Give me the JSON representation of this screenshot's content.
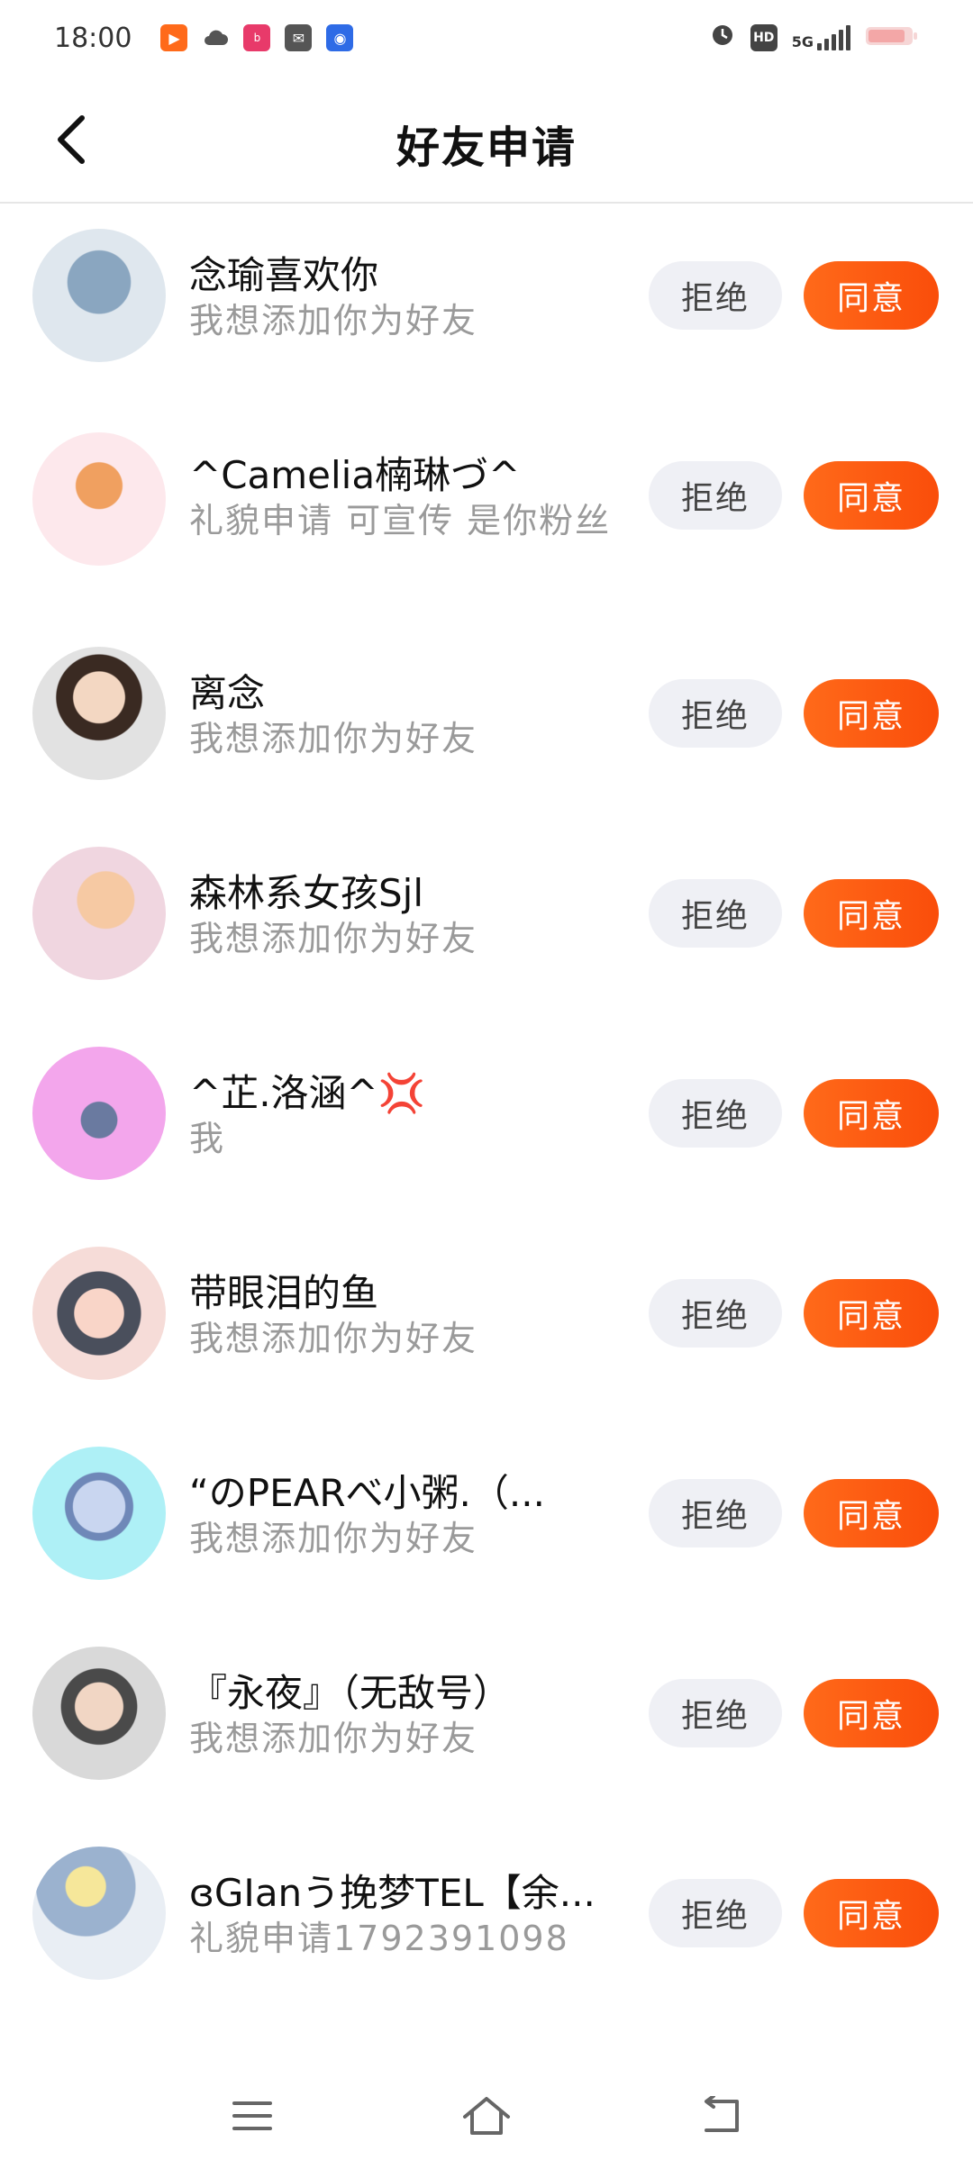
{
  "status_bar": {
    "time": "18:00",
    "network": "5G",
    "hd_label": "HD",
    "icons": [
      "kuaishou-icon",
      "cloud-icon",
      "bilibili-icon",
      "mail-icon",
      "baidu-icon",
      "alarm-icon",
      "hd-icon",
      "signal-icon",
      "battery-icon"
    ]
  },
  "header": {
    "title": "好友申请",
    "back_icon": "chevron-left-icon"
  },
  "actions": {
    "reject": "拒绝",
    "accept": "同意"
  },
  "requests": [
    {
      "name": "念瑜喜欢你",
      "message": "我想添加你为好友",
      "avatar_colors": [
        "#dfe7ee",
        "#8aa6c0"
      ]
    },
    {
      "name": "^Camelia楠琳づ^",
      "message": "礼貌申请 可宣传 是你粉丝",
      "avatar_colors": [
        "#fde8ec",
        "#f0a060"
      ]
    },
    {
      "name": "离念",
      "message": "我想添加你为好友",
      "avatar_colors": [
        "#e2e2e2",
        "#3a2a22"
      ]
    },
    {
      "name": "森林系女孩Sjl",
      "message": "我想添加你为好友",
      "avatar_colors": [
        "#f0d6e0",
        "#f6c9a3"
      ]
    },
    {
      "name": "^芷.洛涵^💢",
      "message": "我",
      "avatar_colors": [
        "#f3a6ec",
        "#6a7aa0"
      ]
    },
    {
      "name": "带眼泪的鱼",
      "message": "我想添加你为好友",
      "avatar_colors": [
        "#f6dcd8",
        "#4a4f5c"
      ]
    },
    {
      "name": "“のPEARべ小粥.（...",
      "message": "我想添加你为好友",
      "avatar_colors": [
        "#aef0f6",
        "#6f88b8"
      ]
    },
    {
      "name": "『永夜』（无敌号）",
      "message": "我想添加你为好友",
      "avatar_colors": [
        "#d9d9d9",
        "#4a4a4a"
      ]
    },
    {
      "name": "ɞGIanう挽梦TEL【余...",
      "message": "礼貌申请1792391098",
      "avatar_colors": [
        "#e9eef4",
        "#9bb2cf"
      ]
    }
  ],
  "nav_bar": {
    "menu_icon": "menu-icon",
    "home_icon": "home-icon",
    "back_icon": "back-icon"
  }
}
